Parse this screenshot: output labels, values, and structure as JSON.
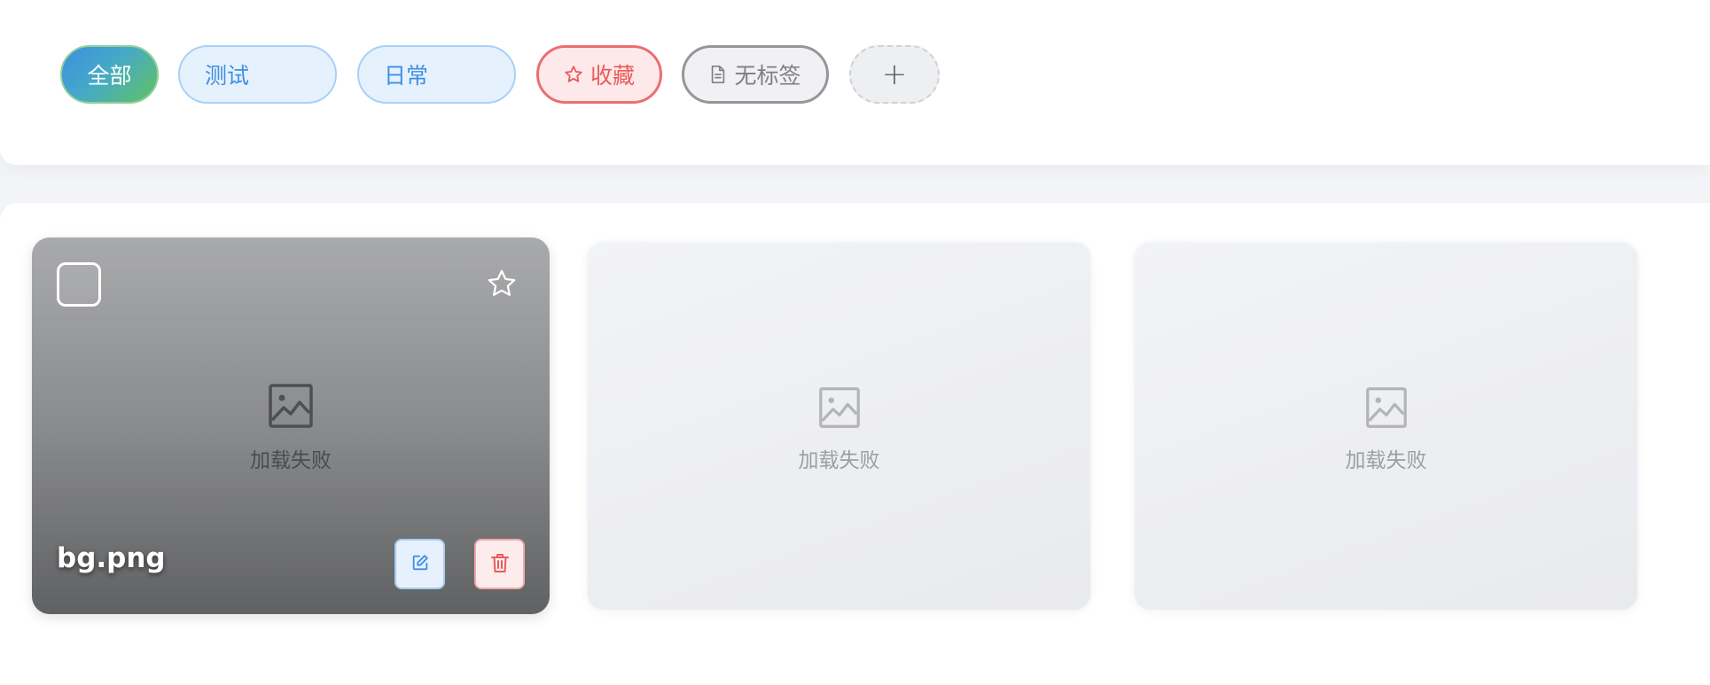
{
  "tags": {
    "all": "全部",
    "test": "测试",
    "daily": "日常",
    "favorites": "收藏",
    "untagged": "无标签",
    "add": "+"
  },
  "cards": [
    {
      "filename": "bg.png",
      "status": "加载失败",
      "selected": false,
      "favorited": false
    },
    {
      "status": "加载失败"
    },
    {
      "status": "加载失败"
    }
  ],
  "icons": {
    "favorites": "star-icon",
    "untagged": "document-icon",
    "placeholder": "image-icon",
    "edit": "edit-icon",
    "delete": "trash-icon"
  },
  "colors": {
    "primary": "#3f8fe0",
    "danger": "#ea5b5b",
    "success": "#62c25f"
  }
}
